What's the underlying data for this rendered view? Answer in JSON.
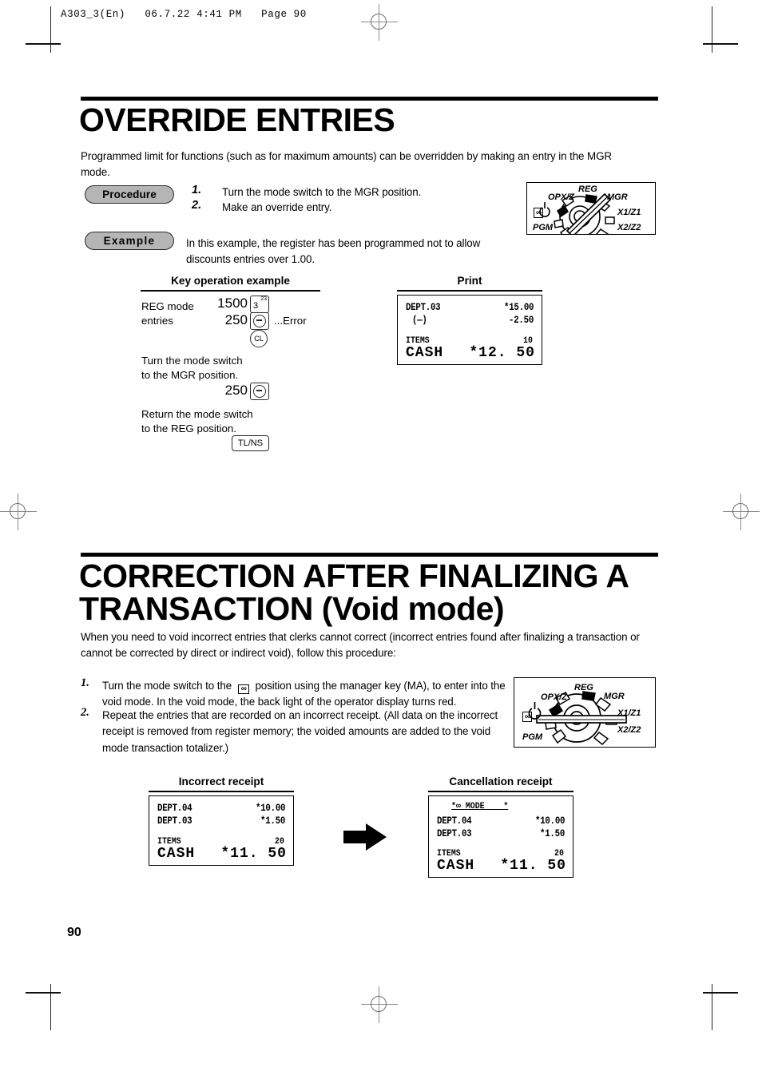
{
  "page": {
    "header_info": "A303_3(En)   06.7.22 4:41 PM   Page 90",
    "page_number": "90"
  },
  "section1": {
    "title": "OVERRIDE ENTRIES",
    "intro": "Programmed limit for functions (such as for maximum amounts) can be overridden by making an entry in the MGR mode.",
    "procedure_badge": "Procedure",
    "example_badge": "Example",
    "steps": [
      {
        "num": "1.",
        "text": "Turn the mode switch to the MGR position."
      },
      {
        "num": "2.",
        "text": "Make an override entry."
      }
    ],
    "example_text": "In this example, the register has been programmed not to allow discounts entries over 1.00.",
    "key_column_caption": "Key operation example",
    "print_column_caption": "Print",
    "key_ops": {
      "line1_label": "REG mode",
      "line2_label": "entries",
      "entry1_amount": "1500",
      "entry1_key_main": "3",
      "entry1_key_sup": "23",
      "entry2_amount": "250",
      "entry2_key": "discount-minus-key",
      "error_note": "...Error",
      "clear_key": "CL",
      "note1_line1": "Turn the mode switch",
      "note1_line2": "to the MGR position.",
      "entry3_amount": "250",
      "entry3_key": "discount-minus-key",
      "note2_line1": "Return the mode switch",
      "note2_line2": "to the REG position.",
      "total_key": "TL/NS"
    },
    "print_receipt": {
      "rows": [
        {
          "label": "DEPT.03",
          "value": "*15.00"
        },
        {
          "label": "(—)",
          "value": "-2.50"
        }
      ],
      "items_label": "ITEMS",
      "items_count": "10",
      "cash_label": "CASH",
      "cash_value": "*12. 50"
    }
  },
  "section2": {
    "title_line1": "CORRECTION AFTER FINALIZING A",
    "title_line2": "TRANSACTION  (Void mode)",
    "intro": "When you need to void incorrect entries that clerks cannot correct (incorrect entries found after finalizing a transaction or cannot be corrected by direct or indirect void), follow this procedure:",
    "steps": [
      {
        "num": "1.",
        "text_before": "Turn the mode switch to the",
        "icon": "void-mode-icon",
        "text_after": "position using the manager key (MA), to enter into the void mode. In the void mode, the back light of the operator display turns red."
      },
      {
        "num": "2.",
        "text": "Repeat the entries that are recorded on an incorrect receipt.  (All data on the incorrect receipt is removed from register memory; the voided amounts are added to the void mode transaction totalizer.)"
      }
    ],
    "incorrect_caption": "Incorrect receipt",
    "cancellation_caption": "Cancellation receipt",
    "incorrect_receipt": {
      "rows": [
        {
          "label": "DEPT.04",
          "value": "*10.00"
        },
        {
          "label": "DEPT.03",
          "value": "*1.50"
        }
      ],
      "items_label": "ITEMS",
      "items_count": "20",
      "cash_label": "CASH",
      "cash_value": "*11. 50"
    },
    "cancellation_receipt": {
      "header": "*∞ MODE    *",
      "rows": [
        {
          "label": "DEPT.04",
          "value": "*10.00"
        },
        {
          "label": "DEPT.03",
          "value": "*1.50"
        }
      ],
      "items_label": "ITEMS",
      "items_count": "20",
      "cash_label": "CASH",
      "cash_value": "*11. 50"
    }
  },
  "mode_dial": {
    "labels": {
      "opxz": "OPX/Z",
      "reg": "REG",
      "mgr": "MGR",
      "x1z1": "X1/Z1",
      "x2z2": "X2/Z2",
      "pgm": "PGM",
      "void": "∞"
    }
  }
}
